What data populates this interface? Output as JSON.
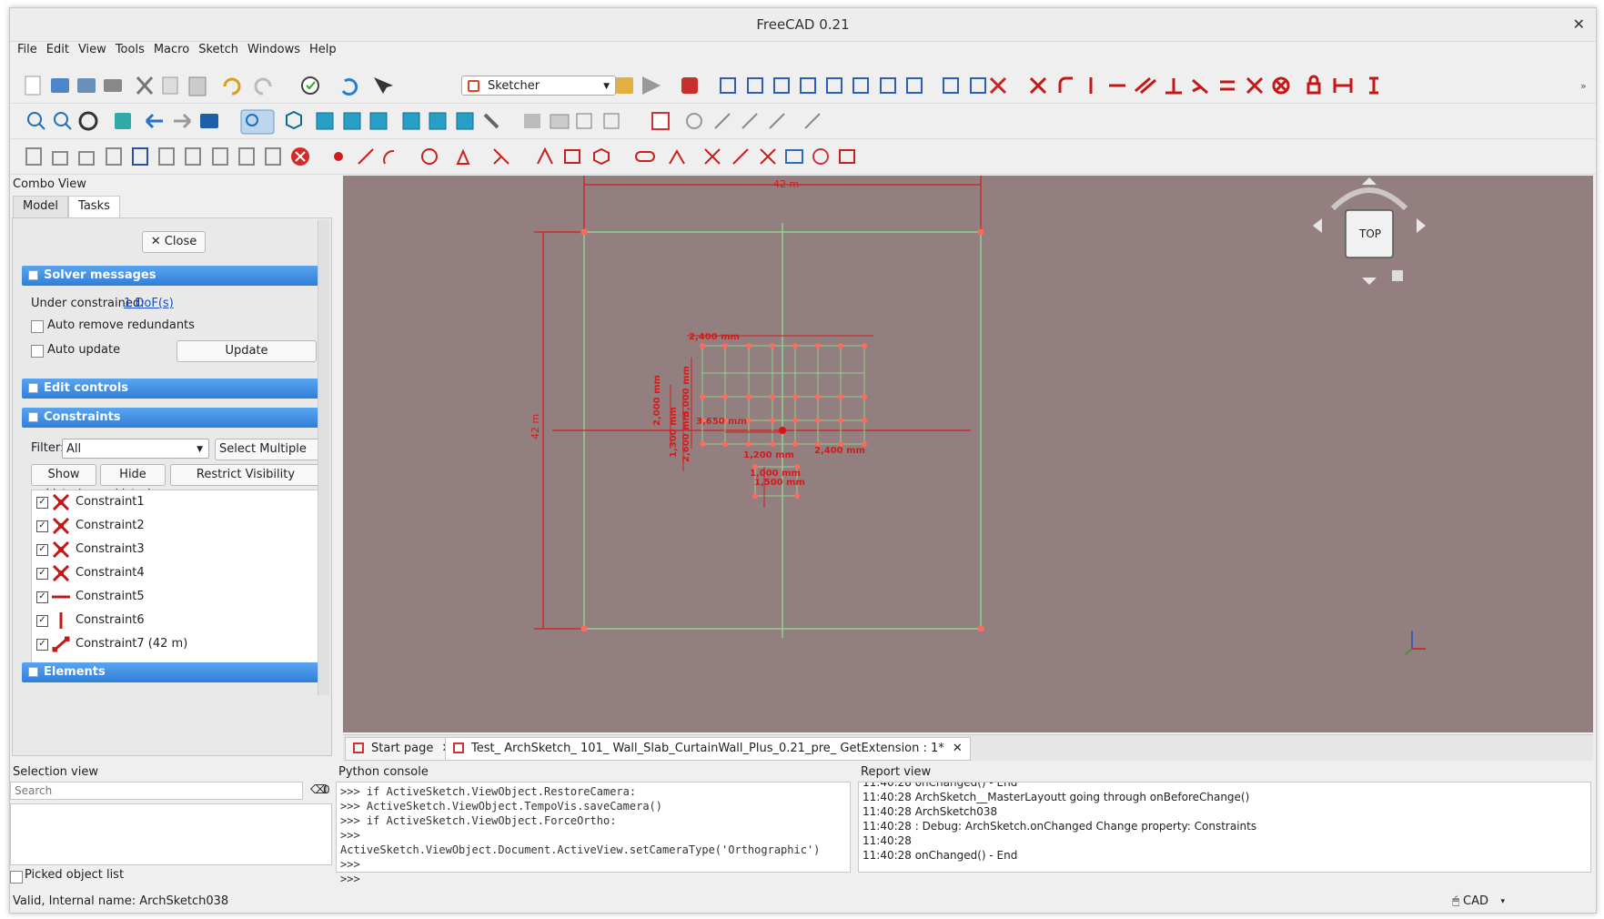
{
  "window": {
    "title": "FreeCAD 0.21",
    "close_glyph": "✕"
  },
  "menu": [
    "File",
    "Edit",
    "View",
    "Tools",
    "Macro",
    "Sketch",
    "Windows",
    "Help"
  ],
  "workbench": {
    "selected": "Sketcher"
  },
  "combo_view": {
    "title": "Combo View",
    "tabs": [
      "Model",
      "Tasks"
    ],
    "close_button": "Close",
    "solver": {
      "header": "Solver messages",
      "under_constrained_label": "Under constrained:",
      "dof_link": "1 DoF(s)",
      "auto_remove": "Auto remove redundants",
      "auto_update": "Auto update",
      "update_button": "Update"
    },
    "edit_controls_header": "Edit controls",
    "constraints": {
      "header": "Constraints",
      "filter_label": "Filter:",
      "filter_value": "All",
      "select_multiple": "Select Multiple",
      "show_listed": "Show Listed",
      "hide_listed": "Hide Listed",
      "restrict_visibility": "Restrict Visibility",
      "items": [
        {
          "label": "Constraint1",
          "icon": "coincident-icon"
        },
        {
          "label": "Constraint2",
          "icon": "coincident-icon"
        },
        {
          "label": "Constraint3",
          "icon": "coincident-icon"
        },
        {
          "label": "Constraint4",
          "icon": "coincident-icon"
        },
        {
          "label": "Constraint5",
          "icon": "horizontal-icon"
        },
        {
          "label": "Constraint6",
          "icon": "vertical-icon"
        },
        {
          "label": "Constraint7 (42 m)",
          "icon": "distance-icon"
        }
      ]
    },
    "elements_header": "Elements"
  },
  "viewport": {
    "background": "#947f80",
    "navcube_face": "TOP",
    "dimensions": {
      "top": "42 m",
      "left": "42 m"
    },
    "labels": [
      "2,400 mm",
      "1,200 mm",
      "2,000 mm",
      "2,600 mm",
      "1,300 mm",
      "3,000 mm",
      "3,650 mm",
      "2,400 mm",
      "1,000 mm",
      "1,500 mm"
    ]
  },
  "document_tabs": [
    {
      "label": "Start page",
      "active": false
    },
    {
      "label": "Test_ ArchSketch_ 101_ Wall_Slab_CurtainWall_Plus_0.21_pre_ GetExtension : 1*",
      "active": true
    }
  ],
  "selection_view": {
    "title": "Selection view",
    "search_placeholder": "Search",
    "count": "0",
    "picked_list": "Picked object list"
  },
  "python_console": {
    "title": "Python console",
    "lines": [
      ">>> if ActiveSketch.ViewObject.RestoreCamera:",
      ">>>   ActiveSketch.ViewObject.TempoVis.saveCamera()",
      ">>>   if ActiveSketch.ViewObject.ForceOrtho:",
      ">>>     ActiveSketch.ViewObject.Document.ActiveView.setCameraType('Orthographic')",
      ">>> ",
      ">>> "
    ]
  },
  "report_view": {
    "title": "Report view",
    "lines": [
      "11:40:28  onChanged() - End",
      "11:40:28  ArchSketch__MasterLayoutt  going through onBeforeChange()",
      "11:40:28  ArchSketch038",
      "11:40:28   : Debug: ArchSketch.onChanged Change property: Constraints",
      "11:40:28",
      "11:40:28  onChanged() - End"
    ]
  },
  "status": {
    "text": "Valid, Internal name: ArchSketch038",
    "nav_style": "CAD"
  }
}
